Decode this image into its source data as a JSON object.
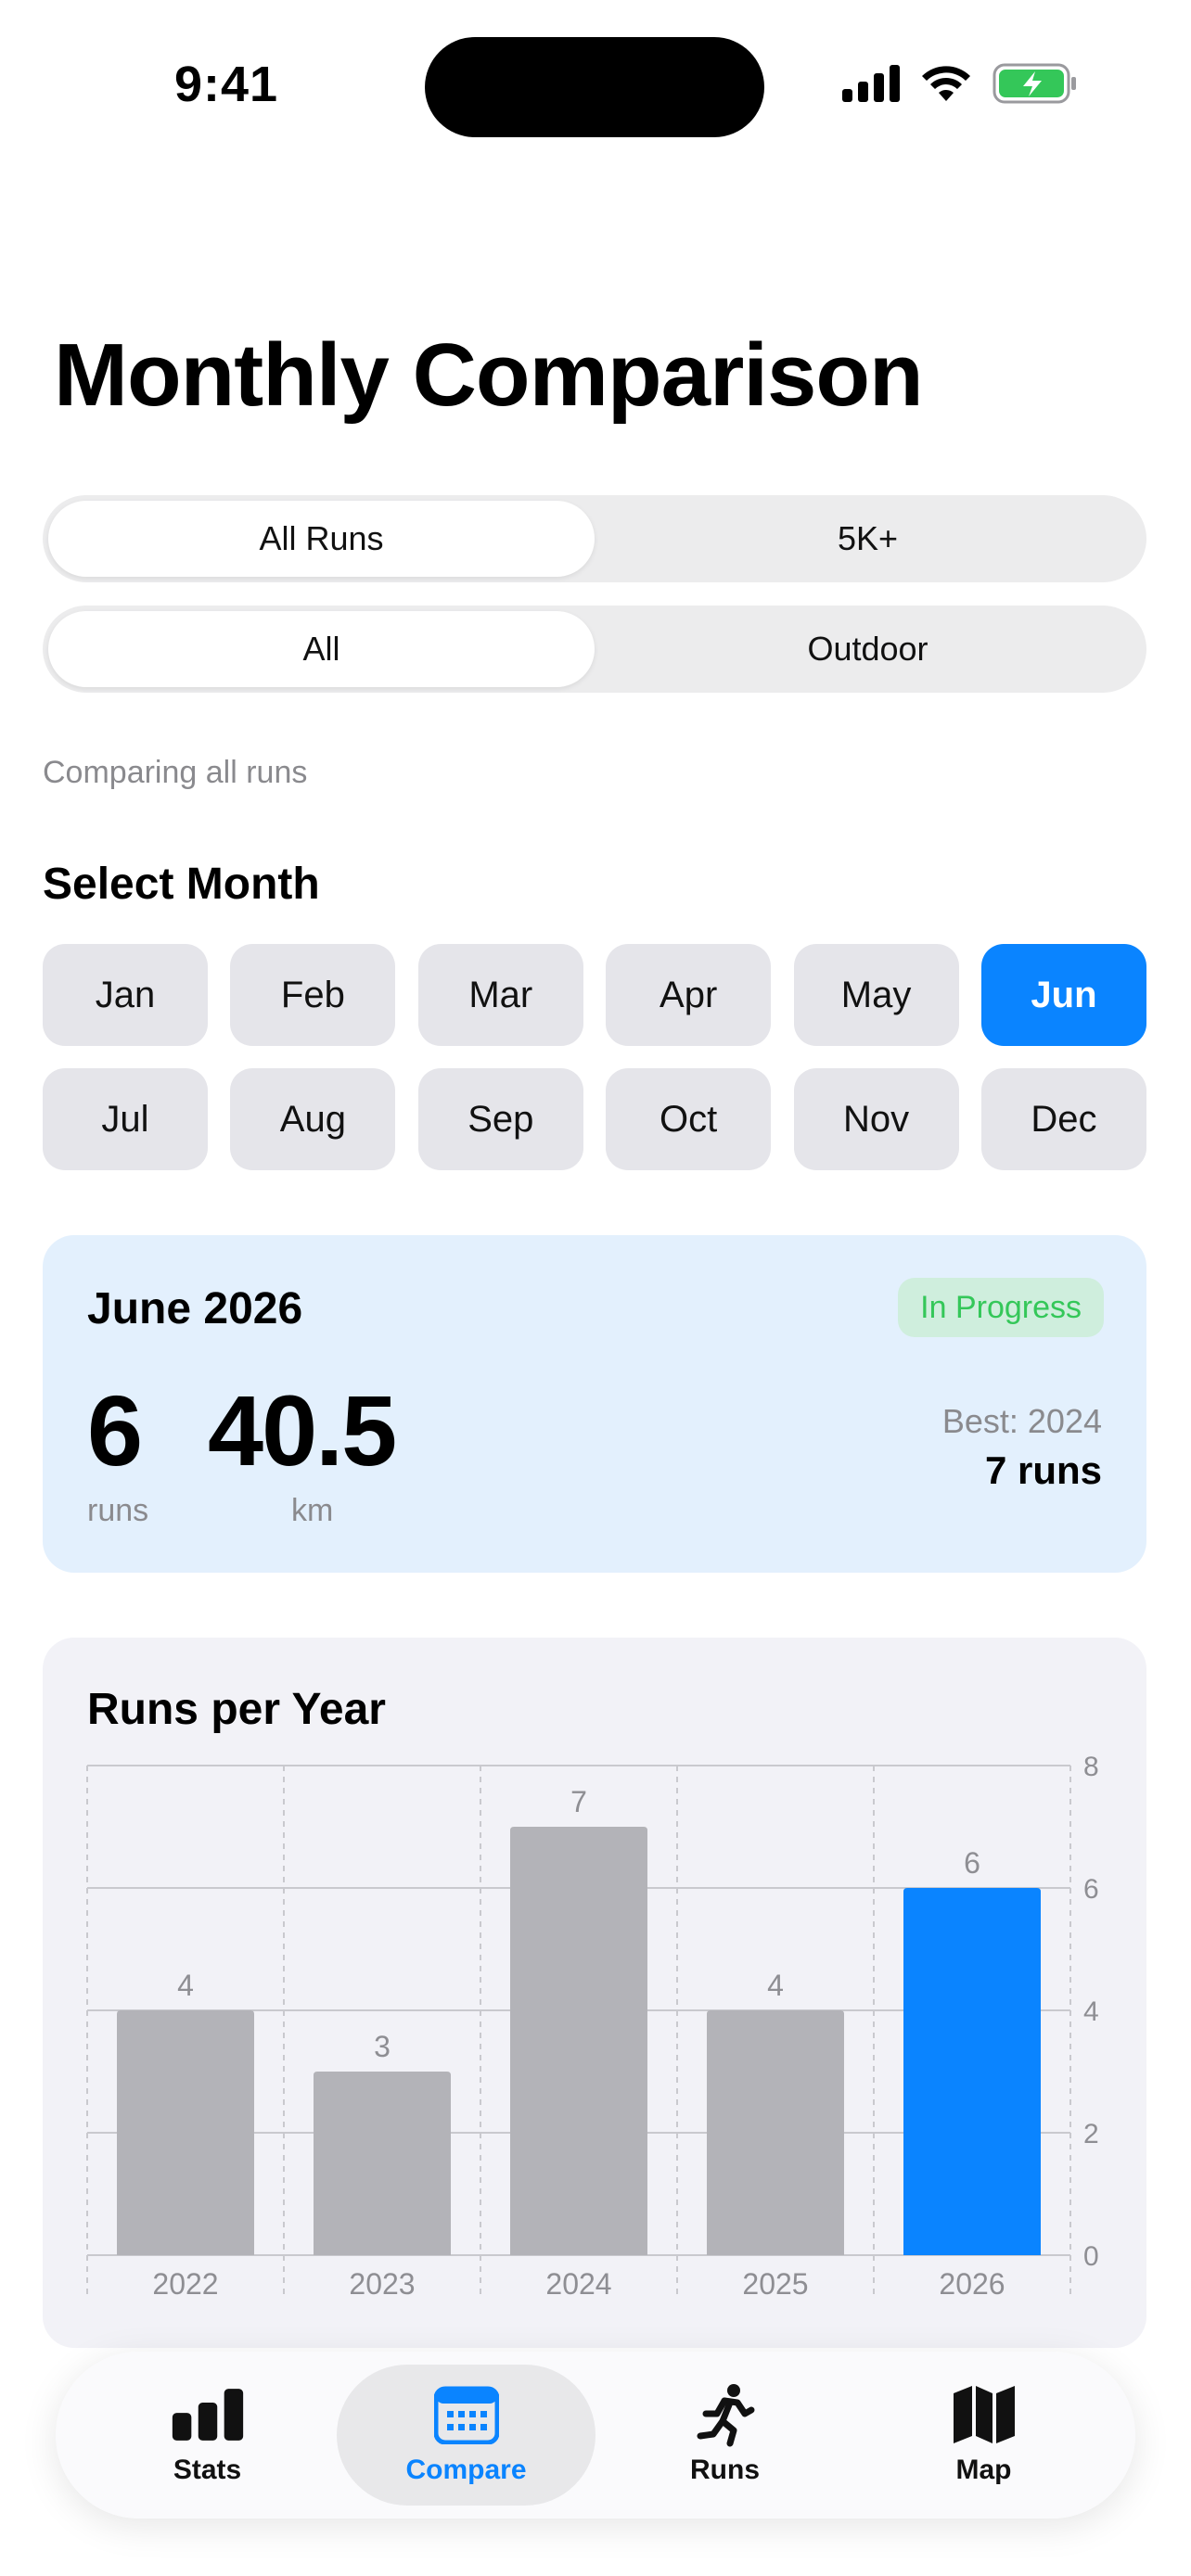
{
  "status_bar": {
    "time": "9:41"
  },
  "page": {
    "title": "Monthly Comparison"
  },
  "filters": {
    "run_type": {
      "options": [
        "All Runs",
        "5K+"
      ],
      "selected": "All Runs"
    },
    "location": {
      "options": [
        "All",
        "Outdoor"
      ],
      "selected": "All"
    },
    "description": "Comparing all runs"
  },
  "month_picker": {
    "heading": "Select Month",
    "months": [
      "Jan",
      "Feb",
      "Mar",
      "Apr",
      "May",
      "Jun",
      "Jul",
      "Aug",
      "Sep",
      "Oct",
      "Nov",
      "Dec"
    ],
    "selected": "Jun"
  },
  "summary": {
    "title": "June 2026",
    "badge": "In Progress",
    "runs_value": "6",
    "runs_label": "runs",
    "distance_value": "40.5",
    "distance_label": "km",
    "best_label": "Best: 2024",
    "best_value": "7 runs"
  },
  "chart": {
    "title": "Runs per Year"
  },
  "chart_data": {
    "type": "bar",
    "title": "Runs per Year",
    "categories": [
      "2022",
      "2023",
      "2024",
      "2025",
      "2026"
    ],
    "values": [
      4,
      3,
      7,
      4,
      6
    ],
    "data_labels": [
      "4",
      "3",
      "7",
      "4",
      "6"
    ],
    "highlight_category": "2026",
    "y_ticks": [
      "0",
      "2",
      "4",
      "6",
      "8"
    ],
    "ylim": [
      0,
      8
    ],
    "y_axis_side": "right",
    "grid": true,
    "colors": {
      "default": "#b3b3b8",
      "highlight": "#0a84ff"
    }
  },
  "tab_bar": {
    "tabs": [
      {
        "label": "Stats",
        "icon": "bar-chart-icon"
      },
      {
        "label": "Compare",
        "icon": "calendar-icon"
      },
      {
        "label": "Runs",
        "icon": "runner-icon"
      },
      {
        "label": "Map",
        "icon": "map-icon"
      }
    ],
    "active": "Compare"
  },
  "colors": {
    "accent": "#0a84ff",
    "success": "#34c759",
    "card_highlight": "#e3f0fd"
  }
}
